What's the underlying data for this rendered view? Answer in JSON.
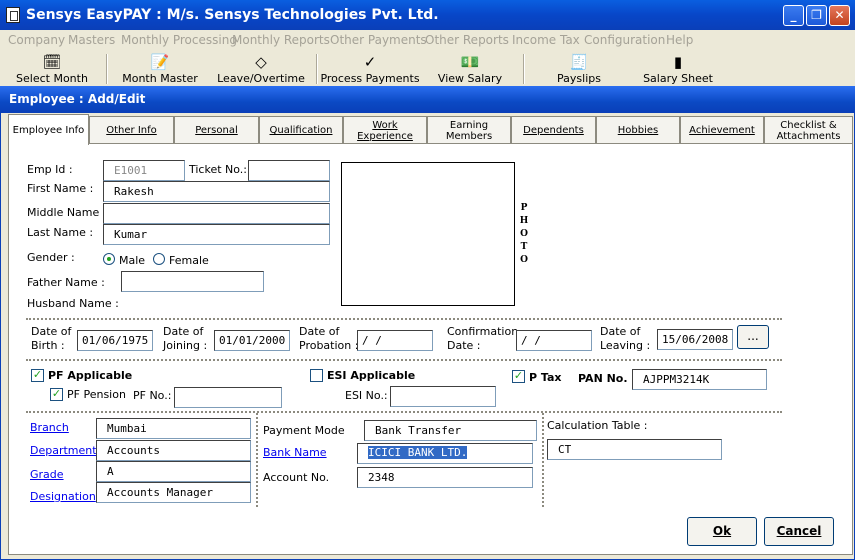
{
  "app": {
    "title": "Sensys EasyPAY : M/s. Sensys Technologies Pvt. Ltd."
  },
  "menu": [
    "Company",
    "Masters",
    "Monthly Processing",
    "Monthly Reports",
    "Other Payments",
    "Other Reports",
    "Income Tax",
    "Configuration",
    "Help"
  ],
  "toolbar": {
    "items": [
      "Select Month",
      "Month Master",
      "Leave/Overtime",
      "Process Payments",
      "View Salary",
      "Payslips",
      "Salary Sheet"
    ]
  },
  "window": {
    "title": "Employee : Add/Edit"
  },
  "tabs": [
    {
      "label": "Employee Info"
    },
    {
      "label": "Other Info"
    },
    {
      "label": "Personal"
    },
    {
      "label": "Qualification"
    },
    {
      "label": "Work Experience"
    },
    {
      "label": "Earning Members"
    },
    {
      "label": "Dependents"
    },
    {
      "label": "Hobbies"
    },
    {
      "label": "Achievement"
    },
    {
      "label": "Checklist & Attachments"
    }
  ],
  "form": {
    "emp_id_label": "Emp Id :",
    "emp_id": "E1001",
    "ticket_label": "Ticket No.:",
    "ticket": "",
    "first_name_label": "First Name :",
    "first_name": "Rakesh",
    "middle_name_label": "Middle Name :",
    "middle_name": "",
    "last_name_label": "Last Name :",
    "last_name": "Kumar",
    "gender_label": "Gender :",
    "male": "Male",
    "female": "Female",
    "father_label": "Father Name :",
    "father": "",
    "husband_label": "Husband Name :",
    "photo_label": "PHOTO",
    "dob_label_1": "Date of",
    "dob_label_2": "Birth :",
    "dob": "01/06/1975",
    "doj_label_1": "Date of",
    "doj_label_2": "Joining :",
    "doj": "01/01/2000",
    "dop_label_1": "Date of",
    "dop_label_2": "Probation :",
    "dop": " / /",
    "conf_label_1": "Confirmation",
    "conf_label_2": "Date :",
    "conf": " / /",
    "dol_label_1": "Date of",
    "dol_label_2": "Leaving :",
    "dol": "15/06/2008",
    "ellipsis": "...",
    "pf_applicable": "PF Applicable",
    "pf_pension": "PF Pension",
    "pf_no_label": "PF No.:",
    "pf_no": "",
    "esi_applicable": "ESI Applicable",
    "esi_no_label": "ESI No.:",
    "esi_no": "",
    "ptax": "P Tax",
    "pan_label": "PAN No. :",
    "pan": "AJPPM3214K",
    "branch_label": "Branch",
    "branch": "Mumbai",
    "department_label": "Department",
    "department": "Accounts",
    "grade_label": "Grade",
    "grade": "A",
    "designation_label": "Designation",
    "designation": "Accounts Manager",
    "payment_mode_label": "Payment Mode",
    "payment_mode": "Bank Transfer",
    "bank_name_label": "Bank Name",
    "bank_name": "ICICI BANK LTD.",
    "account_no_label": "Account No.",
    "account_no": "2348",
    "calc_table_label": "Calculation Table :",
    "calc_table": "CT"
  },
  "buttons": {
    "ok": "Ok",
    "cancel": "Cancel"
  }
}
